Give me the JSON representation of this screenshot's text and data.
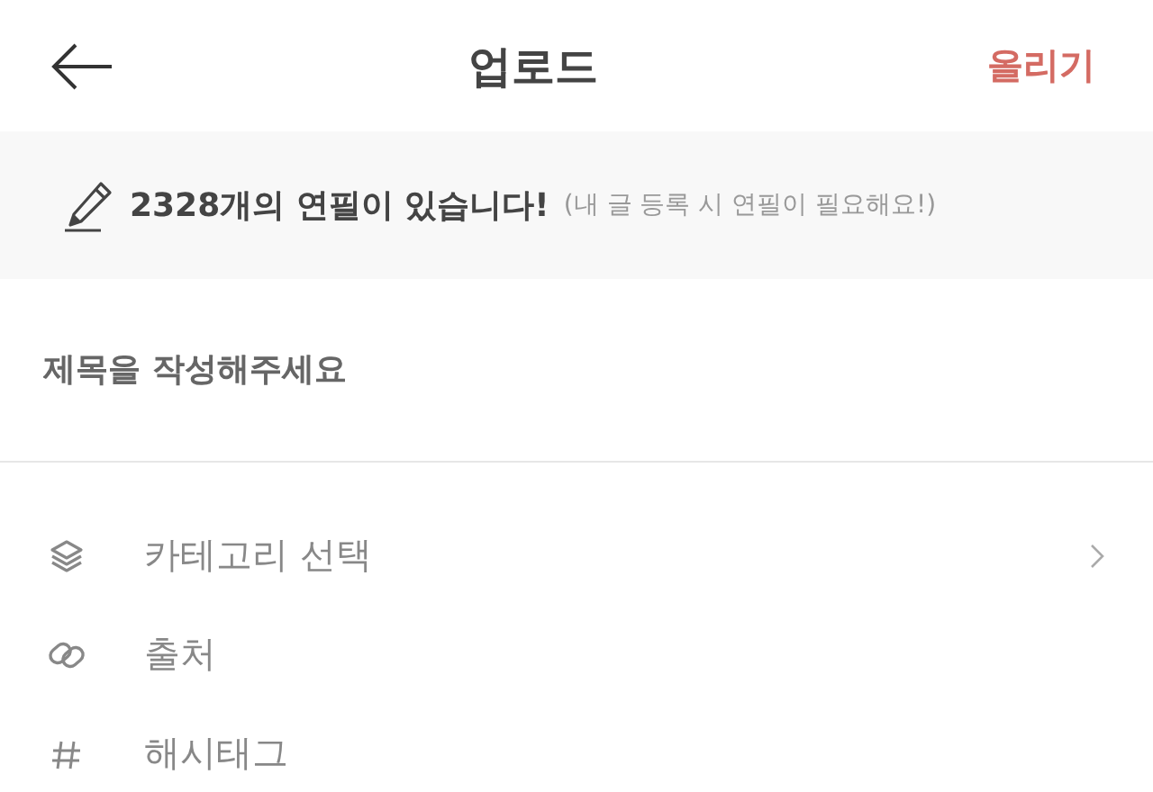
{
  "header": {
    "title": "업로드",
    "action": "올리기"
  },
  "notice": {
    "message": "2328개의 연필이 있습니다!",
    "hint": "(내 글 등록 시 연필이 필요해요!)"
  },
  "title_field": {
    "placeholder": "제목을 작성해주세요"
  },
  "options": [
    {
      "kind": "category",
      "label": "카테고리 선택",
      "has_arrow": true
    },
    {
      "kind": "source",
      "label": "출처",
      "has_arrow": false
    },
    {
      "kind": "hashtag",
      "label": "해시태그",
      "has_arrow": false
    }
  ]
}
